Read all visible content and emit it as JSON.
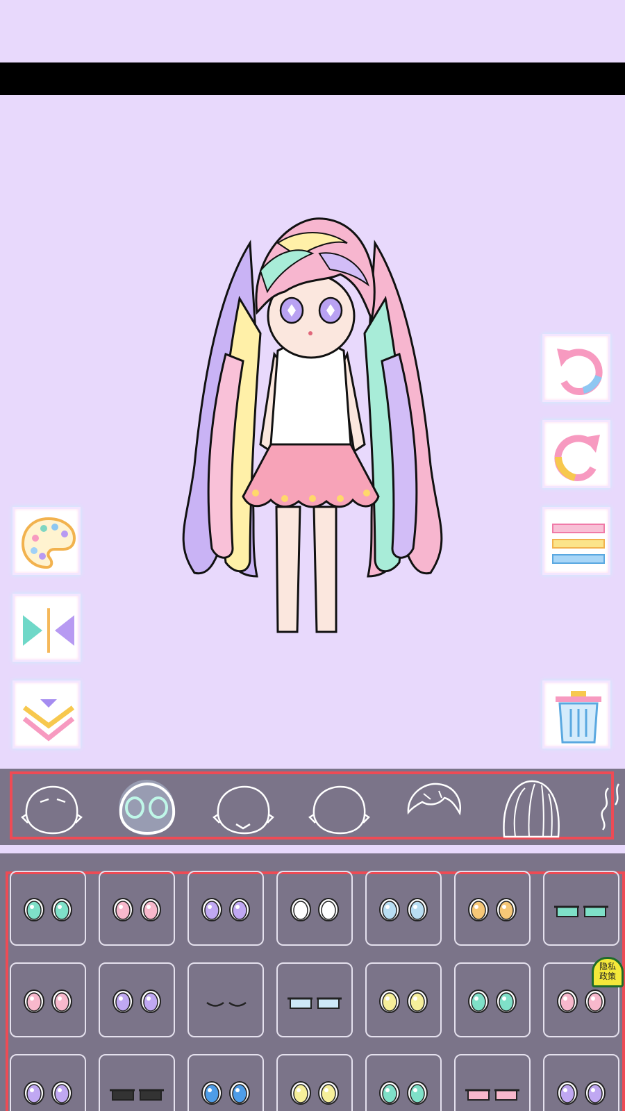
{
  "privacy_badge": {
    "line1": "隐私",
    "line2": "政策"
  },
  "colors": {
    "background": "#e8d9fc",
    "panel": "#7b7489",
    "highlight_border": "#ee4b55"
  },
  "tools_left": [
    {
      "name": "palette-button",
      "icon": "palette-icon"
    },
    {
      "name": "flip-button",
      "icon": "flip-horizontal-icon"
    },
    {
      "name": "collapse-button",
      "icon": "chevron-down-icon"
    }
  ],
  "tools_right": [
    {
      "name": "undo-button",
      "icon": "undo-icon"
    },
    {
      "name": "redo-button",
      "icon": "redo-icon"
    },
    {
      "name": "menu-button",
      "icon": "menu-icon"
    },
    {
      "name": "delete-button",
      "icon": "trash-icon"
    }
  ],
  "categories": [
    "face-category",
    "eyes-category",
    "mouth-category",
    "head-category",
    "bangs-category",
    "hair-category",
    "back-hair-category"
  ],
  "selected_category": "eyes-category",
  "eye_options": [
    "mint",
    "pink",
    "lavender",
    "white",
    "lightblue",
    "orange",
    "mint-half",
    "pink",
    "lavender-tear",
    "closed",
    "lightblue-half",
    "yellow",
    "mint",
    "pink-lash",
    "lavender",
    "dark-half",
    "blue-sparkle",
    "yellow",
    "mint",
    "pink-half",
    "lavender"
  ]
}
